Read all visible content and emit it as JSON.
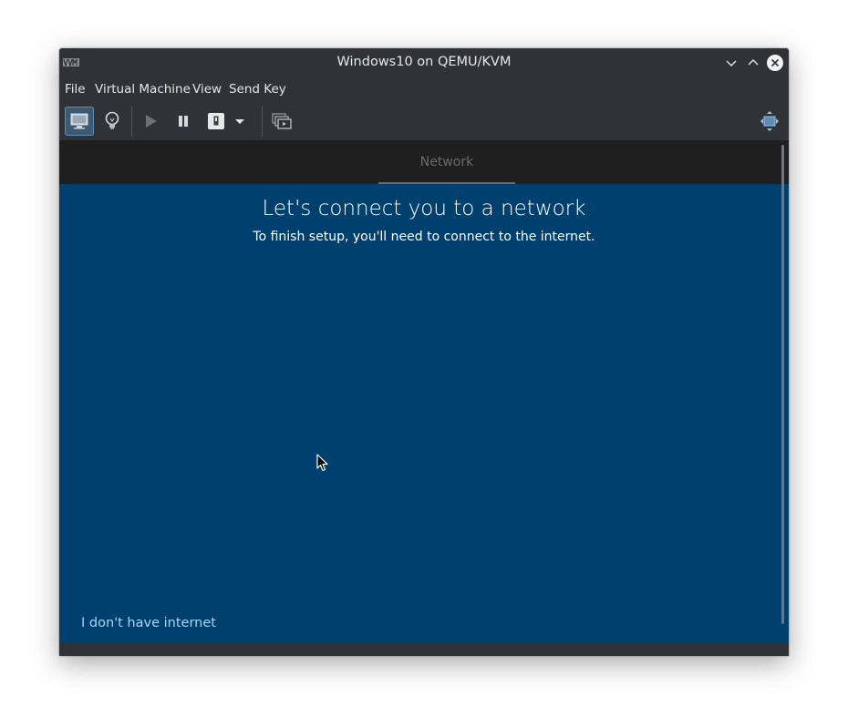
{
  "window": {
    "title": "Windows10 on QEMU/KVM",
    "controls": [
      "minimize",
      "maximize",
      "close"
    ]
  },
  "menubar": {
    "items": [
      "File",
      "Virtual Machine",
      "View",
      "Send Key"
    ]
  },
  "toolbar": {
    "buttons": [
      {
        "name": "console",
        "icon": "monitor-icon",
        "active": true
      },
      {
        "name": "details",
        "icon": "lightbulb-icon"
      },
      {
        "name": "run",
        "icon": "play-icon",
        "enabled": false
      },
      {
        "name": "pause",
        "icon": "pause-icon"
      },
      {
        "name": "shutdown",
        "icon": "power-icon"
      },
      {
        "name": "shutdown-menu",
        "icon": "dropdown-arrow-icon"
      },
      {
        "name": "snapshots",
        "icon": "snapshots-icon"
      },
      {
        "name": "fullscreen",
        "icon": "fullscreen-icon"
      }
    ]
  },
  "guest": {
    "tab": "Network",
    "heading": "Let's connect you to a network",
    "subheading": "To finish setup, you'll need to connect to the internet.",
    "no_internet_link": "I don't have internet"
  },
  "colors": {
    "chrome": "#2f3237",
    "oobe_blue": "#00406f",
    "oobe_header": "#1f1f1f",
    "link": "#a9d4f5"
  }
}
